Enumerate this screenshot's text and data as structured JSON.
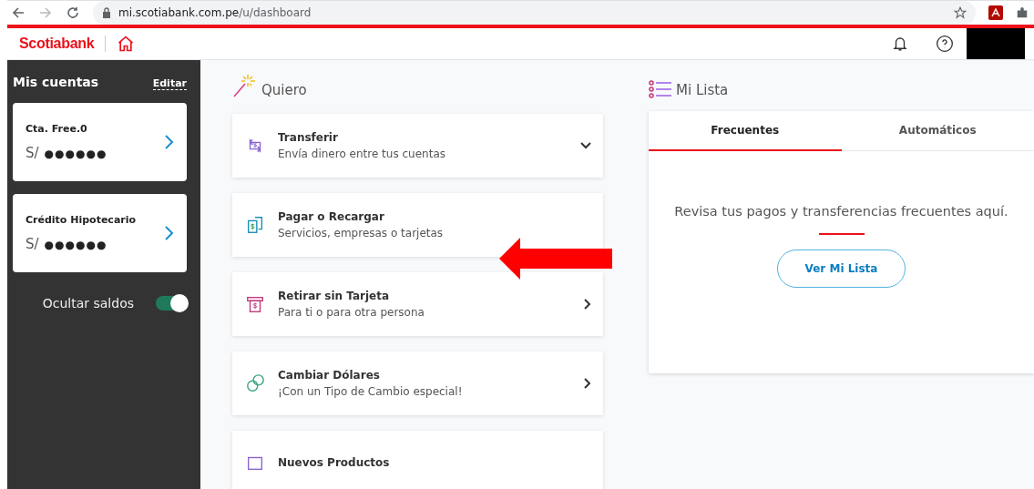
{
  "browser": {
    "url_host": "mi.scotiabank.com.pe",
    "url_path": "/u/dashboard"
  },
  "header": {
    "brand": "Scotiabank"
  },
  "sidebar": {
    "title": "Mis cuentas",
    "edit_link": "Editar",
    "accounts": [
      {
        "name": "Cta. Free.0",
        "currency": "S/",
        "balance": "●●●●●●"
      },
      {
        "name": "Crédito Hipotecario",
        "currency": "S/",
        "balance": "●●●●●●"
      }
    ],
    "hide_balances": {
      "label": "Ocultar saldos",
      "on": true
    }
  },
  "quiero": {
    "title": "Quiero",
    "actions": [
      {
        "kind": "transfer",
        "title": "Transferir",
        "subtitle": "Envía dinero entre tus cuentas",
        "chevron": true,
        "expandable": true
      },
      {
        "kind": "pay",
        "title": "Pagar o Recargar",
        "subtitle": "Servicios, empresas o tarjetas",
        "chevron": false,
        "expandable": false
      },
      {
        "kind": "withdraw",
        "title": "Retirar sin Tarjeta",
        "subtitle": "Para ti o para otra persona",
        "chevron": true,
        "expandable": false
      },
      {
        "kind": "exchange",
        "title": "Cambiar Dólares",
        "subtitle": "¡Con un Tipo de Cambio especial!",
        "chevron": true,
        "expandable": false
      },
      {
        "kind": "products",
        "title": "Nuevos Productos",
        "chevron": false,
        "expandable": false
      }
    ]
  },
  "mi_lista": {
    "title": "Mi Lista",
    "tabs": [
      {
        "label": "Frecuentes",
        "selected": true
      },
      {
        "label": "Automáticos",
        "selected": false
      }
    ],
    "message": "Revisa tus pagos y transferencias frecuentes aquí.",
    "button": "Ver Mi Lista"
  }
}
